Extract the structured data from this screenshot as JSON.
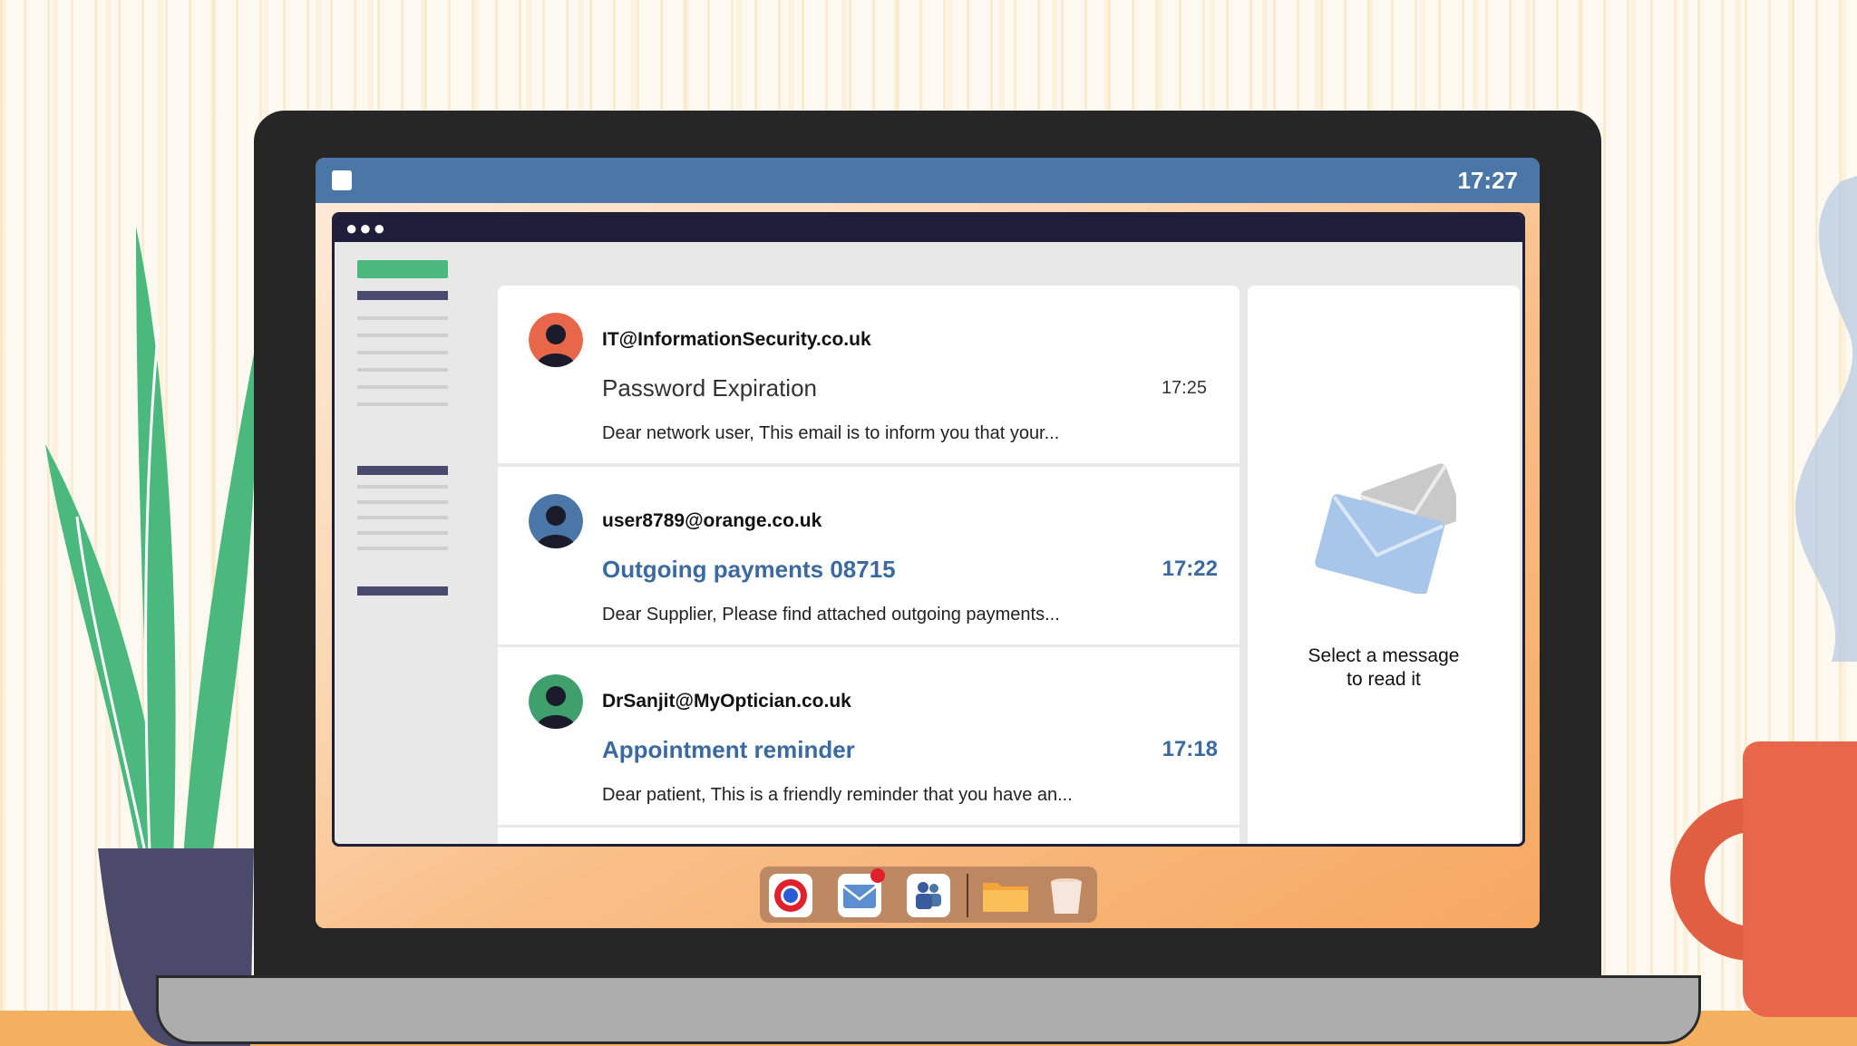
{
  "menubar": {
    "clock": "17:27"
  },
  "emails": [
    {
      "sender": "IT@InformationSecurity.co.uk",
      "subject": "Password Expiration",
      "time": "17:25",
      "preview": "Dear network user, This email is to inform you that your...",
      "read": true,
      "avatar_color": "#e8674a"
    },
    {
      "sender": "user8789@orange.co.uk",
      "subject": "Outgoing payments 08715",
      "time": "17:22",
      "preview": "Dear Supplier, Please find attached outgoing payments...",
      "read": false,
      "avatar_color": "#4a77a8"
    },
    {
      "sender": "DrSanjit@MyOptician.co.uk",
      "subject": "Appointment reminder",
      "time": "17:18",
      "preview": "Dear patient, This is a friendly reminder that you have an...",
      "read": false,
      "avatar_color": "#3fa06e"
    }
  ],
  "reading_pane": {
    "line1": "Select a message",
    "line2": "to read it"
  },
  "dock": {
    "items": [
      "browser-icon",
      "mail-icon",
      "teams-icon",
      "folder-icon",
      "trash-icon"
    ],
    "mail_badge_color": "#e0202a"
  },
  "colors": {
    "accent_blue": "#3b6aa0",
    "menubar": "#4a77a8",
    "sidebar_green": "#4bb87e"
  }
}
